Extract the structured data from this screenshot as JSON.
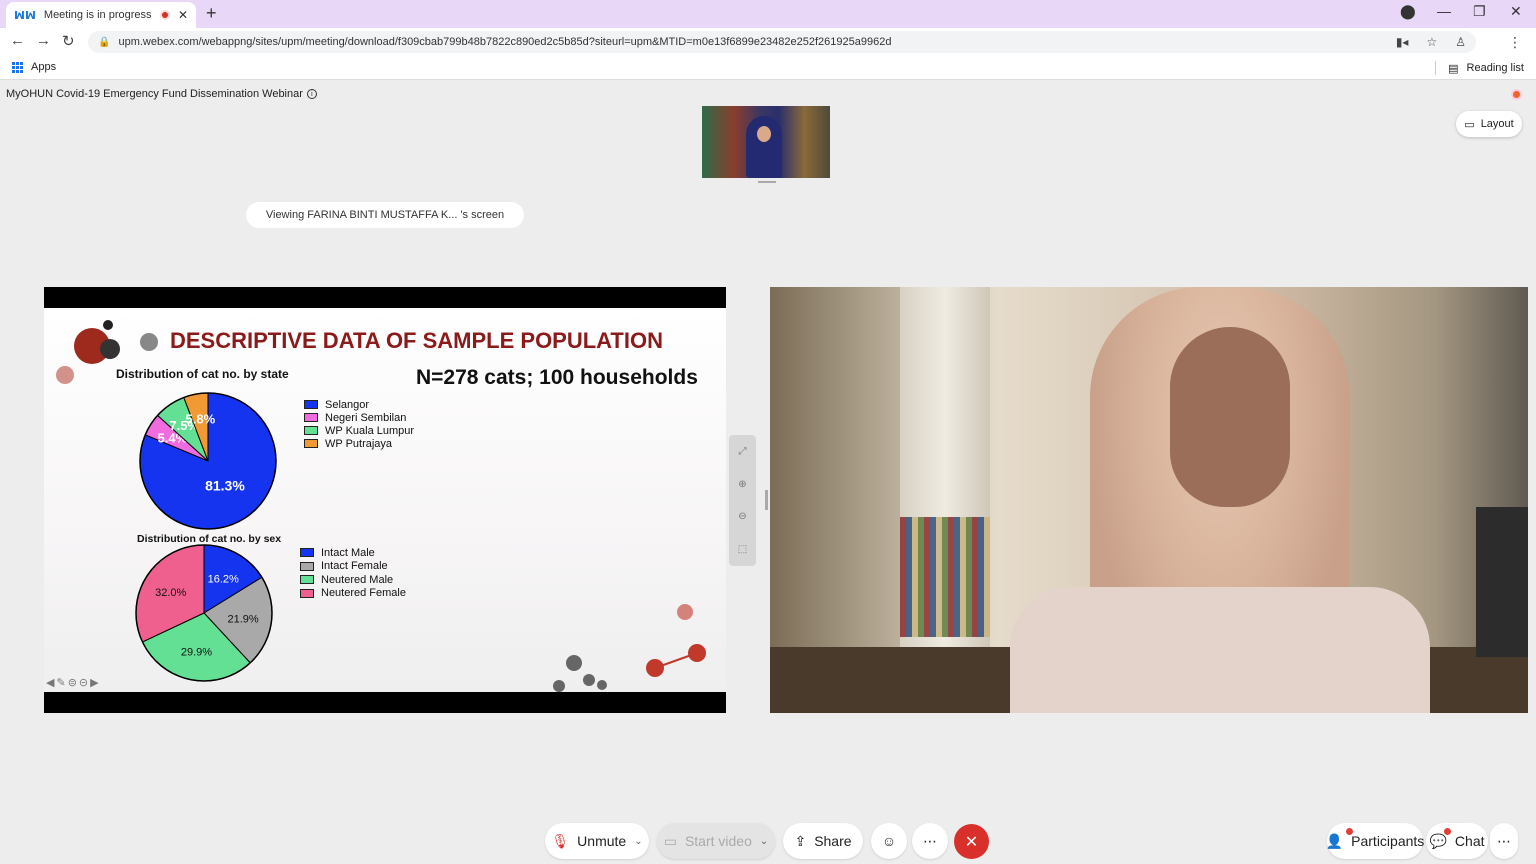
{
  "browser": {
    "tab_title": "Meeting is in progress...",
    "favicon": "webex-icon",
    "url": "upm.webex.com/webappng/sites/upm/meeting/download/f309cbab799b48b7822c890ed2c5b85d?siteurl=upm&MTID=m0e13f6899e23482e252f261925a9962d",
    "bookmarks_apps": "Apps",
    "reading_list": "Reading list"
  },
  "meeting": {
    "title": "MyOHUN Covid-19 Emergency Fund Dissemination Webinar",
    "layout_label": "Layout",
    "viewing_label": "Viewing FARINA BINTI MUSTAFFA K...  's screen"
  },
  "slide": {
    "title": "DESCRIPTIVE DATA OF SAMPLE POPULATION",
    "subtitle": "N=278 cats; 100 households"
  },
  "chart_data": [
    {
      "type": "pie",
      "title": "Distribution of cat no. by state",
      "categories": [
        "Selangor",
        "Negeri Sembilan",
        "WP Kuala Lumpur",
        "WP Putrajaya"
      ],
      "values": [
        81.3,
        5.4,
        7.5,
        5.8
      ],
      "labels": [
        "81.3%",
        "5.4%",
        "7.5%",
        "5.8%"
      ],
      "colors": [
        "#1534f0",
        "#f06be0",
        "#63e094",
        "#f19a33"
      ],
      "legend": "right"
    },
    {
      "type": "pie",
      "title": "Distribution of cat no. by sex",
      "categories": [
        "Intact Male",
        "Intact Female",
        "Neutered Male",
        "Neutered Female"
      ],
      "values": [
        16.2,
        21.9,
        29.9,
        32.0
      ],
      "labels": [
        "16.2%",
        "21.9%",
        "29.9%",
        "32.0%"
      ],
      "colors": [
        "#1534f0",
        "#a9a9a9",
        "#63e094",
        "#f0608e"
      ],
      "legend": "right"
    }
  ],
  "controls": {
    "unmute": "Unmute",
    "start_video": "Start video",
    "share": "Share",
    "participants": "Participants",
    "chat": "Chat"
  }
}
